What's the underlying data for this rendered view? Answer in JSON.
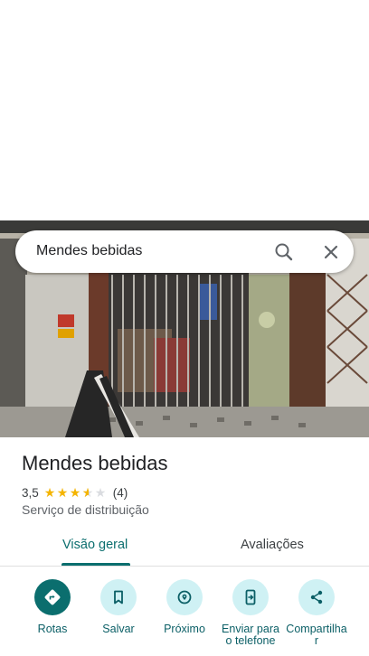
{
  "search": {
    "query": "Mendes bebidas",
    "search_icon": "search-icon",
    "close_icon": "close-icon"
  },
  "place": {
    "name": "Mendes bebidas",
    "rating": "3,5",
    "rating_value": 3.5,
    "review_count": "(4)",
    "category": "Serviço de distribuição"
  },
  "tabs": [
    {
      "label": "Visão geral",
      "active": true
    },
    {
      "label": "Avaliações",
      "active": false
    }
  ],
  "actions": [
    {
      "label": "Rotas",
      "icon": "directions-icon"
    },
    {
      "label": "Salvar",
      "icon": "bookmark-icon"
    },
    {
      "label": "Próximo",
      "icon": "nearby-icon"
    },
    {
      "label": "Enviar para o telefone",
      "icon": "send-to-phone-icon"
    },
    {
      "label": "Compartilhar",
      "icon": "share-icon"
    }
  ],
  "colors": {
    "accent": "#0b6e6e",
    "action_bg": "#cff1f4",
    "star": "#f4b400"
  }
}
